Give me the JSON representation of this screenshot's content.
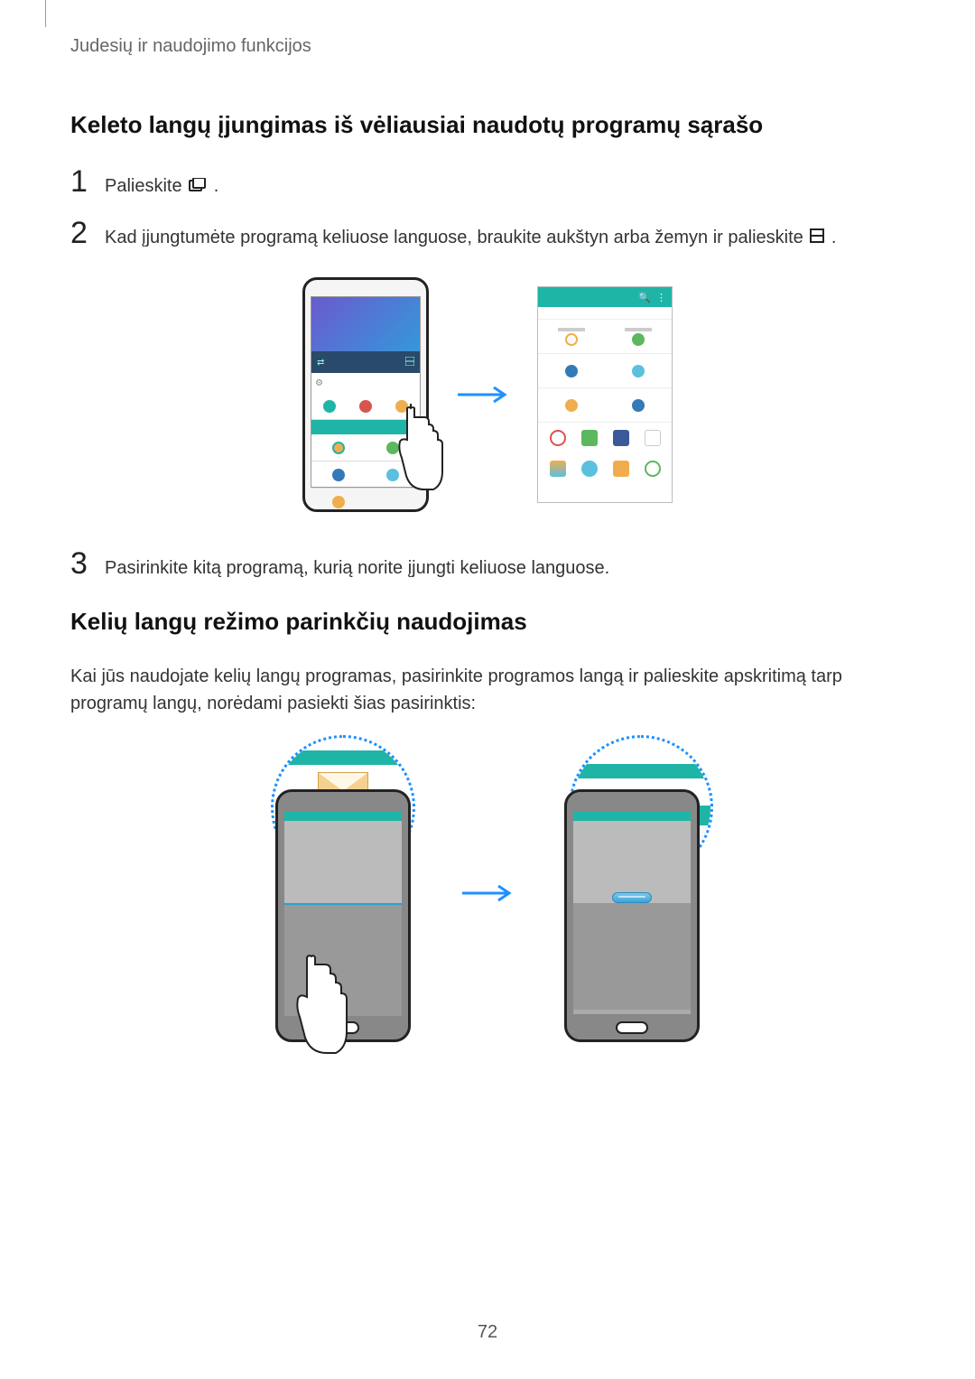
{
  "breadcrumb": "Judesių ir naudojimo funkcijos",
  "heading1": "Keleto langų įjungimas iš vėliausiai naudotų programų sąrašo",
  "steps1": {
    "s1": {
      "num": "1",
      "text_before": "Palieskite ",
      "text_after": "."
    },
    "s2": {
      "num": "2",
      "text_before": "Kad įjungtumėte programą keliuose languose, braukite aukštyn arba žemyn ir palieskite ",
      "text_after": "."
    },
    "s3": {
      "num": "3",
      "text": "Pasirinkite kitą programą, kurią norite įjungti keliuose languose."
    }
  },
  "heading2": "Kelių langų režimo parinkčių naudojimas",
  "para2": "Kai jūs naudojate kelių langų programas, pasirinkite programos langą ir palieskite apskritimą tarp programų langų, norėdami pasiekti šias pasirinktis:",
  "pageNumber": "72",
  "icons": {
    "recent": "recent-apps-icon",
    "multiwindow": "multiwindow-icon",
    "search": "search-icon",
    "more": "more-icon"
  }
}
